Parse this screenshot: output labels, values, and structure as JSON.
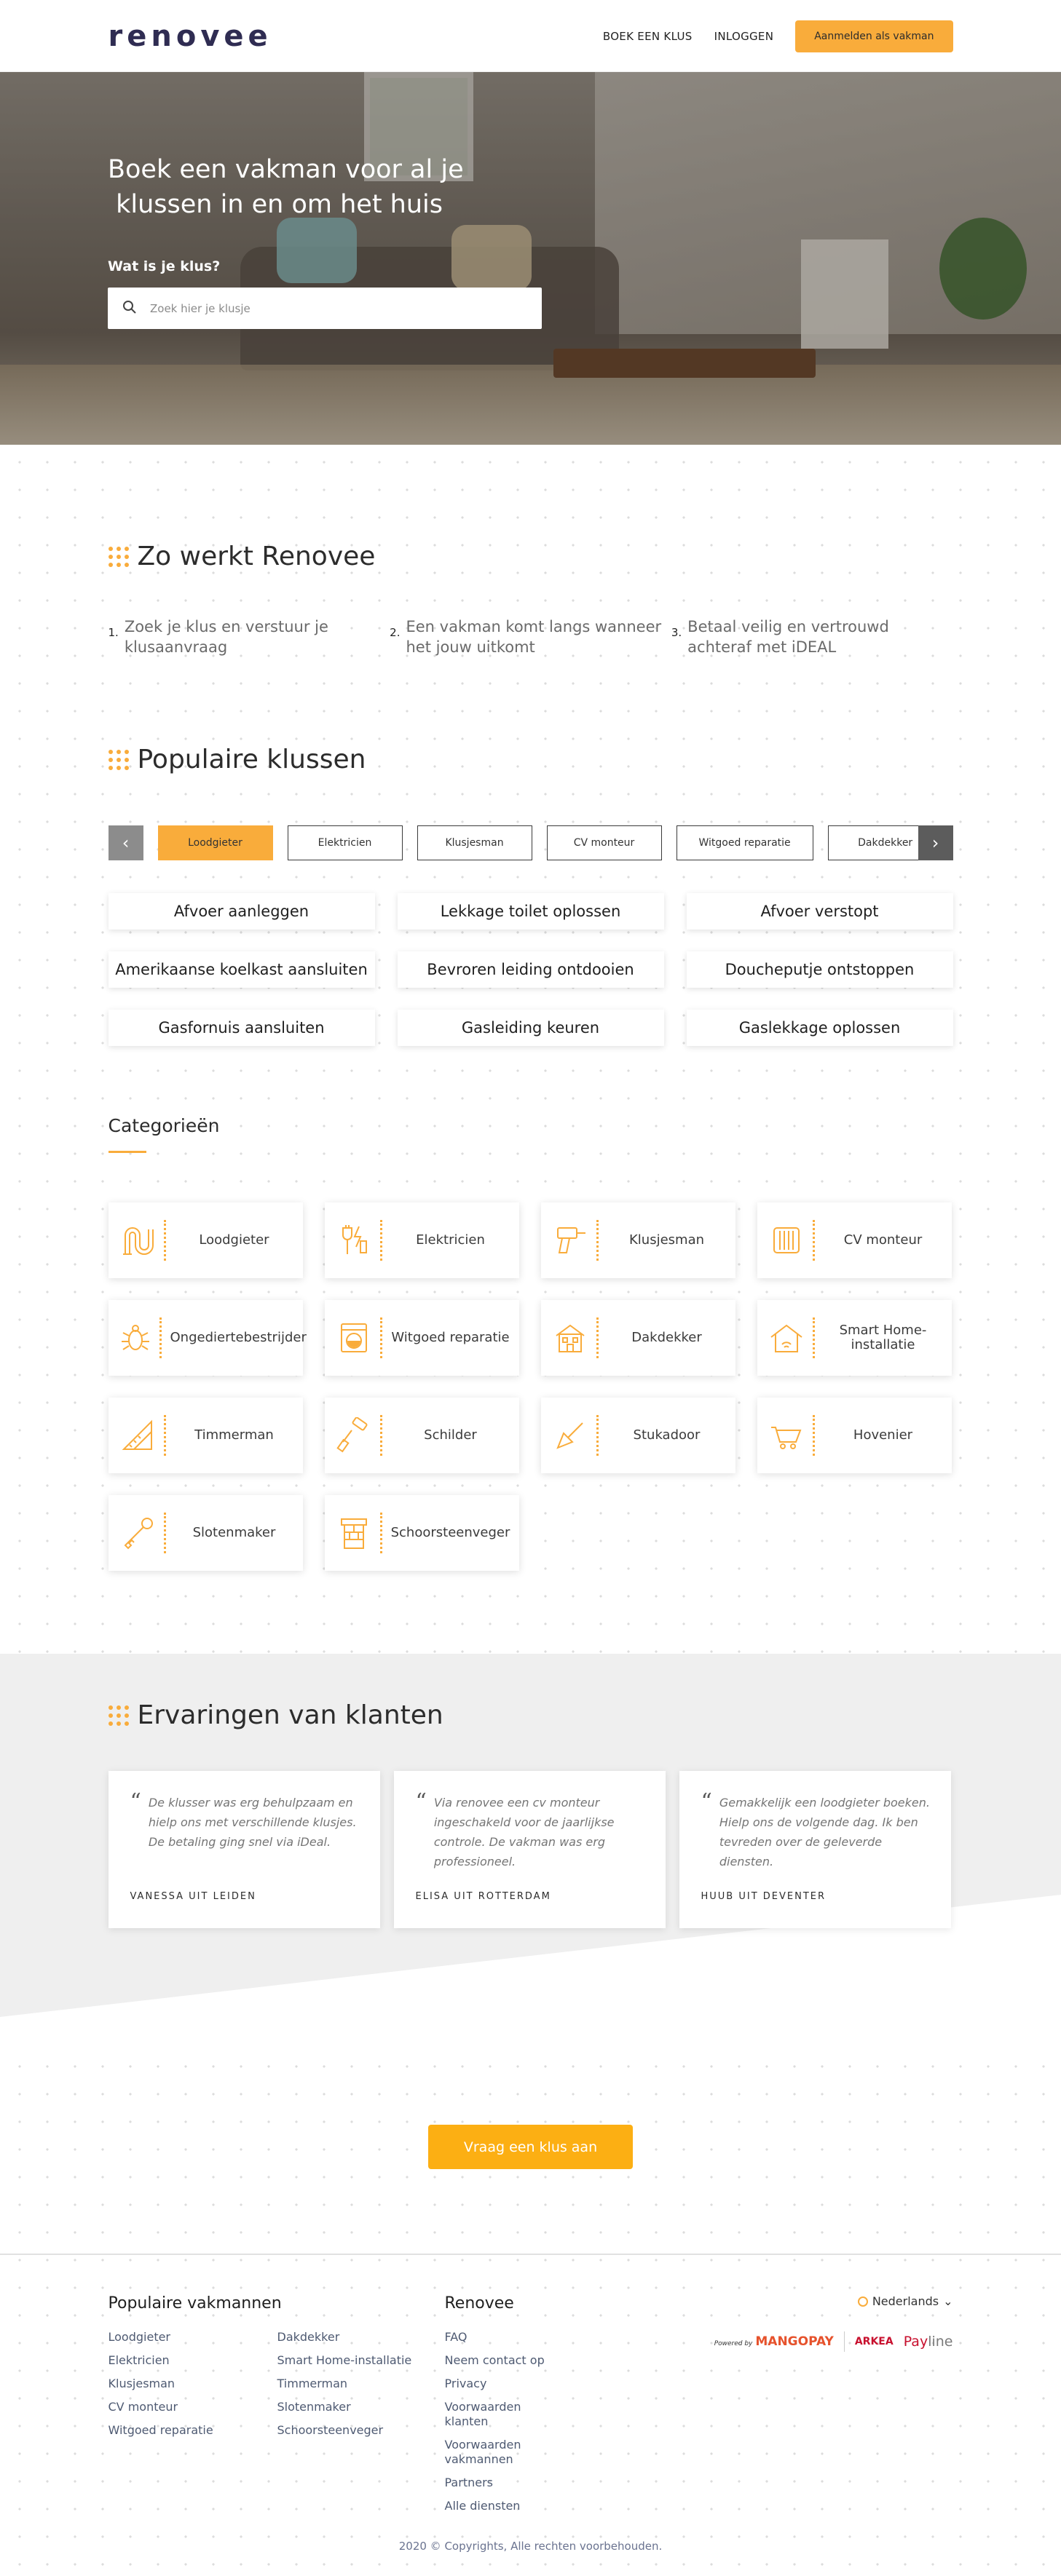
{
  "header": {
    "logo": "renovee",
    "nav": {
      "book": "BOEK EEN KLUS",
      "login": "INLOGGEN",
      "signup": "Aanmelden als vakman"
    }
  },
  "hero": {
    "title_line1": "Boek een vakman voor al je",
    "title_line2": " klussen in en om het huis",
    "label": "Wat is je klus?",
    "search_placeholder": "Zoek hier je klusje"
  },
  "how": {
    "title": "Zo werkt Renovee",
    "steps": [
      {
        "num": "1.",
        "text": "Zoek je klus en verstuur je klusaanvraag"
      },
      {
        "num": "2.",
        "text": "Een vakman komt langs wanneer het jouw uitkomt"
      },
      {
        "num": "3.",
        "text": "Betaal veilig en vertrouwd achteraf met iDEAL"
      }
    ]
  },
  "popular": {
    "title": "Populaire klussen",
    "tabs": [
      "Loodgieter",
      "Elektricien",
      "Klusjesman",
      "CV monteur",
      "Witgoed reparatie",
      "Dakdekker"
    ],
    "jobs": [
      "Afvoer aanleggen",
      "Lekkage toilet oplossen",
      "Afvoer verstopt",
      "Amerikaanse koelkast aansluiten",
      "Bevroren leiding ontdooien",
      "Doucheputje ontstoppen",
      "Gasfornuis aansluiten",
      "Gasleiding keuren",
      "Gaslekkage oplossen"
    ]
  },
  "categories": {
    "title": "Categorieën",
    "items": [
      {
        "name": "Loodgieter",
        "icon": "pipe-icon"
      },
      {
        "name": "Elektricien",
        "icon": "plug-icon"
      },
      {
        "name": "Klusjesman",
        "icon": "drill-icon"
      },
      {
        "name": "CV monteur",
        "icon": "radiator-icon"
      },
      {
        "name": "Ongediertebestrijder",
        "icon": "bug-icon"
      },
      {
        "name": "Witgoed reparatie",
        "icon": "washing-machine-icon"
      },
      {
        "name": "Dakdekker",
        "icon": "house-roof-icon"
      },
      {
        "name": "Smart Home-installatie",
        "icon": "smart-home-icon"
      },
      {
        "name": "Timmerman",
        "icon": "ruler-icon"
      },
      {
        "name": "Schilder",
        "icon": "paint-roller-icon"
      },
      {
        "name": "Stukadoor",
        "icon": "trowel-icon"
      },
      {
        "name": "Hovenier",
        "icon": "wheelbarrow-icon"
      },
      {
        "name": "Slotenmaker",
        "icon": "key-icon"
      },
      {
        "name": "Schoorsteenveger",
        "icon": "chimney-icon"
      }
    ]
  },
  "testimonials": {
    "title": "Ervaringen van klanten",
    "items": [
      {
        "text": "De klusser was erg behulpzaam en hielp ons met verschillende klusjes. De betaling ging snel via iDeal.",
        "author": "VANESSA UIT LEIDEN"
      },
      {
        "text": "Via renovee een cv monteur ingeschakeld voor de jaarlijkse controle. De vakman was erg professioneel.",
        "author": "ELISA UIT ROTTERDAM"
      },
      {
        "text": "Gemakkelijk een loodgieter boeken. Hielp ons de volgende dag. Ik ben tevreden over de geleverde diensten.",
        "author": "HUUB UIT DEVENTER"
      }
    ]
  },
  "cta": {
    "label": "Vraag een klus aan"
  },
  "footer": {
    "popular_title": "Populaire vakmannen",
    "popular_links": [
      "Loodgieter",
      "Dakdekker",
      "Elektricien",
      "Smart Home-installatie",
      "Klusjesman",
      "Timmerman",
      "CV monteur",
      "Slotenmaker",
      "Witgoed reparatie",
      "Schoorsteenveger"
    ],
    "renovee_title": "Renovee",
    "renovee_links": [
      "FAQ",
      "Neem contact op",
      "Privacy",
      "Voorwaarden klanten",
      "Voorwaarden vakmannen",
      "Partners",
      "Alle diensten"
    ],
    "language": "Nederlands",
    "payments": {
      "powered": "Powered by",
      "mangopay": "MANGOPAY",
      "arkea": "ARKEA",
      "payline_a": "Pay",
      "payline_b": "line"
    },
    "copyright": "2020 © Copyrights, Alle rechten voorbehouden."
  },
  "colors": {
    "accent": "#f9ac3b",
    "cta": "#fcaf13",
    "logo": "#2f2c52"
  }
}
